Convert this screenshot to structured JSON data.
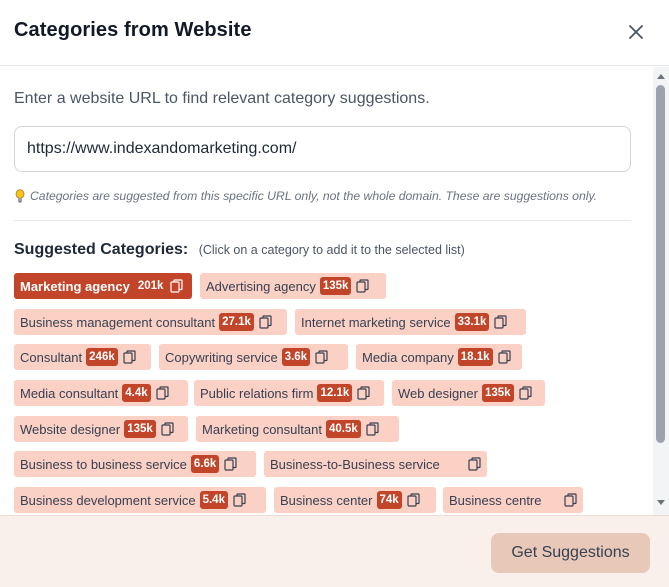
{
  "dialog": {
    "title": "Categories from Website",
    "close_icon": "close-icon"
  },
  "intro_text": "Enter a website URL to find relevant category suggestions.",
  "url_input": {
    "value": "https://www.indexandomarketing.com/"
  },
  "hint": {
    "icon": "lightbulb-icon",
    "text": "Categories are suggested from this specific URL only, not the whole domain. These are suggestions only."
  },
  "suggested": {
    "title": "Suggested Categories:",
    "note": "(Click on a category to add it to the selected list)",
    "chips": [
      {
        "label": "Marketing agency",
        "count": "201k",
        "selected": true
      },
      {
        "label": "Advertising agency",
        "count": "135k",
        "selected": false
      },
      {
        "label": "Business management consultant",
        "count": "27.1k",
        "selected": false
      },
      {
        "label": "Internet marketing service",
        "count": "33.1k",
        "selected": false
      },
      {
        "label": "Consultant",
        "count": "246k",
        "selected": false
      },
      {
        "label": "Copywriting service",
        "count": "3.6k",
        "selected": false
      },
      {
        "label": "Media company",
        "count": "18.1k",
        "selected": false
      },
      {
        "label": "Media consultant",
        "count": "4.4k",
        "selected": false
      },
      {
        "label": "Public relations firm",
        "count": "12.1k",
        "selected": false
      },
      {
        "label": "Web designer",
        "count": "135k",
        "selected": false
      },
      {
        "label": "Website designer",
        "count": "135k",
        "selected": false
      },
      {
        "label": "Marketing consultant",
        "count": "40.5k",
        "selected": false
      },
      {
        "label": "Business to business service",
        "count": "6.6k",
        "selected": false
      },
      {
        "label": "Business-to-Business service",
        "count": "",
        "selected": false
      },
      {
        "label": "Business development service",
        "count": "5.4k",
        "selected": false
      },
      {
        "label": "Business center",
        "count": "74k",
        "selected": false
      },
      {
        "label": "Business centre",
        "count": "",
        "selected": false
      }
    ]
  },
  "footer": {
    "button_label": "Get Suggestions"
  },
  "colors": {
    "accent": "#c2452a",
    "chip_bg": "#fbd0c5",
    "footer_bg": "#f9efeb",
    "button_bg": "#e8c8b8"
  }
}
